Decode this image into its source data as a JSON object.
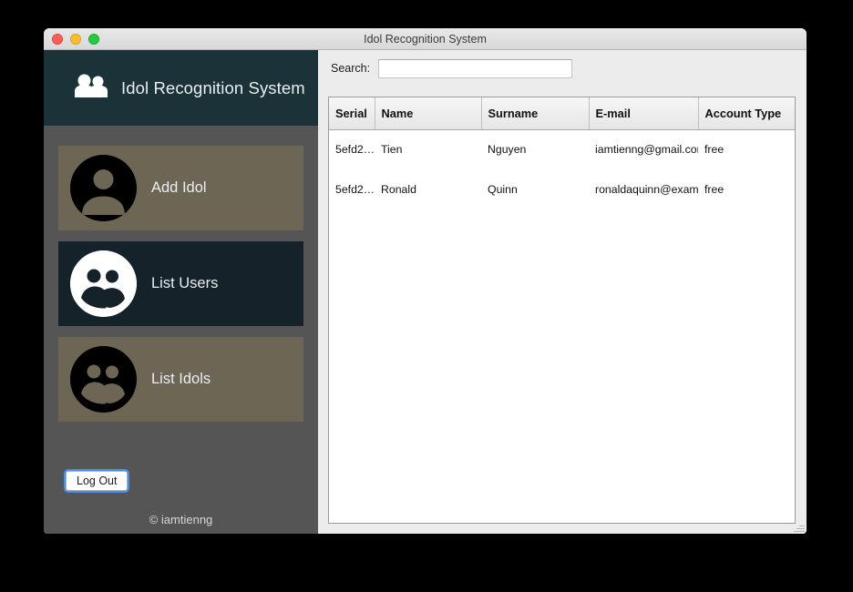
{
  "window": {
    "title": "Idol Recognition System",
    "controls": {
      "close": "close",
      "minimize": "minimize",
      "maximize": "maximize"
    }
  },
  "sidebar": {
    "brand": {
      "text": "Idol Recognition System",
      "icon": "people-icon"
    },
    "nav": [
      {
        "label": "Add Idol",
        "icon": "person-circle-icon",
        "active": false
      },
      {
        "label": "List Users",
        "icon": "people-circle-icon",
        "active": true
      },
      {
        "label": "List Idols",
        "icon": "people-circle-icon",
        "active": false
      }
    ],
    "logout_label": "Log Out",
    "copyright": "© iamtienng"
  },
  "content": {
    "search": {
      "label": "Search:",
      "value": "",
      "placeholder": ""
    },
    "table": {
      "columns": [
        "Serial",
        "Name",
        "Surname",
        "E-mail",
        "Account Type"
      ],
      "rows": [
        {
          "serial": "5efd2…",
          "name": "Tien",
          "surname": "Nguyen",
          "email": "iamtienng@gmail.com",
          "account_type": "free"
        },
        {
          "serial": "5efd2…",
          "name": "Ronald",
          "surname": "Quinn",
          "email": "ronaldaquinn@exam…",
          "account_type": "free"
        }
      ]
    }
  },
  "colors": {
    "brand_dark": "#1b3338",
    "sidebar_bg": "#555555",
    "nav_tan": "#6d6655",
    "nav_active": "#152229",
    "content_bg": "#ececec",
    "focus_ring": "#4a90e2"
  }
}
